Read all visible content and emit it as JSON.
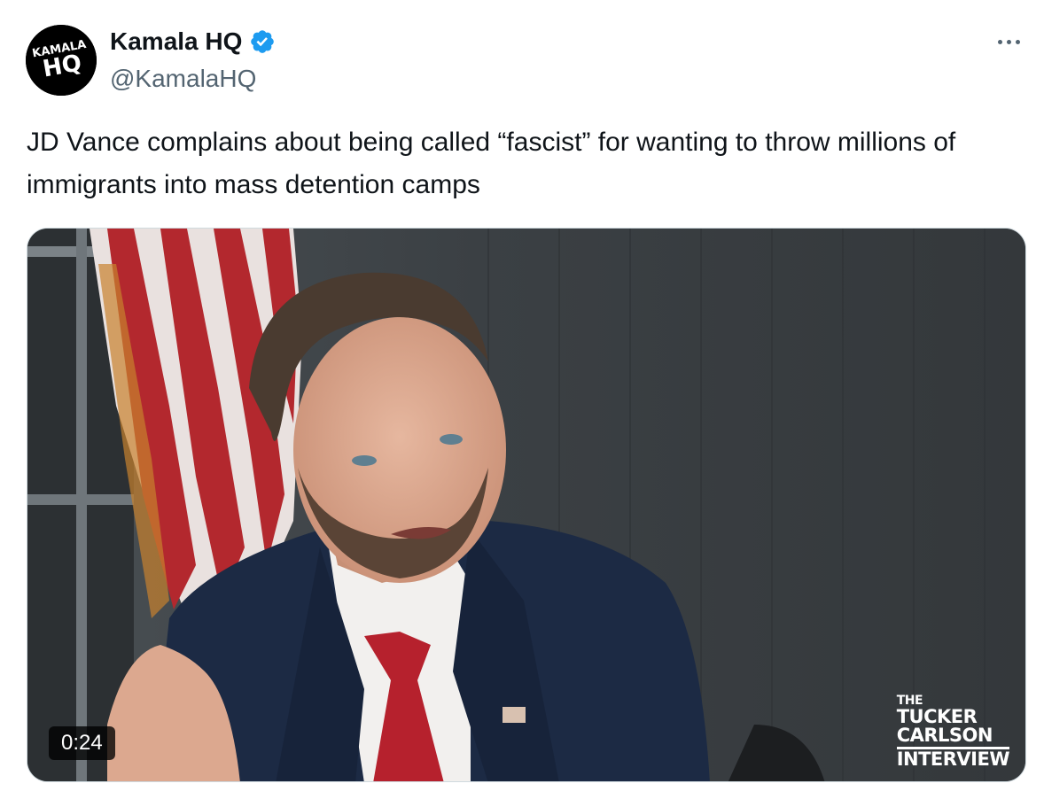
{
  "author": {
    "display_name": "Kamala HQ",
    "handle": "@KamalaHQ",
    "avatar_text_top": "KAMALA",
    "avatar_text_bottom": "HQ",
    "verified": true,
    "verified_color": "#1d9bf0"
  },
  "tweet": {
    "text": "JD Vance complains about being called “fascist” for wanting to throw millions of immigrants into mass detention camps"
  },
  "media": {
    "type": "video",
    "duration": "0:24",
    "watermark": {
      "line1": "THE",
      "line2": "TUCKER",
      "line3": "CARLSON",
      "line4": "INTERVIEW"
    }
  },
  "icons": {
    "more": "more-icon",
    "verified": "verified-badge-icon"
  }
}
